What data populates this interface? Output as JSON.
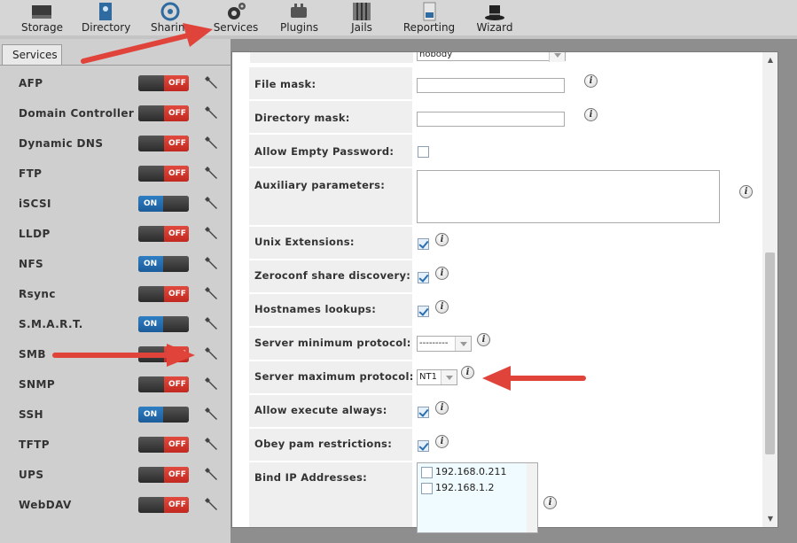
{
  "topnav": [
    {
      "label": "Storage",
      "icon": "storage-icon"
    },
    {
      "label": "Directory",
      "icon": "directory-icon"
    },
    {
      "label": "Sharing",
      "icon": "sharing-icon"
    },
    {
      "label": "Services",
      "icon": "services-icon"
    },
    {
      "label": "Plugins",
      "icon": "plugins-icon"
    },
    {
      "label": "Jails",
      "icon": "jails-icon"
    },
    {
      "label": "Reporting",
      "icon": "reporting-icon"
    },
    {
      "label": "Wizard",
      "icon": "wizard-icon"
    }
  ],
  "tab": {
    "label": "Services"
  },
  "services": [
    {
      "name": "AFP",
      "state": "OFF"
    },
    {
      "name": "Domain Controller",
      "state": "OFF"
    },
    {
      "name": "Dynamic DNS",
      "state": "OFF"
    },
    {
      "name": "FTP",
      "state": "OFF"
    },
    {
      "name": "iSCSI",
      "state": "ON"
    },
    {
      "name": "LLDP",
      "state": "OFF"
    },
    {
      "name": "NFS",
      "state": "ON"
    },
    {
      "name": "Rsync",
      "state": "OFF"
    },
    {
      "name": "S.M.A.R.T.",
      "state": "ON"
    },
    {
      "name": "SMB",
      "state": "OFF"
    },
    {
      "name": "SNMP",
      "state": "OFF"
    },
    {
      "name": "SSH",
      "state": "ON"
    },
    {
      "name": "TFTP",
      "state": "OFF"
    },
    {
      "name": "UPS",
      "state": "OFF"
    },
    {
      "name": "WebDAV",
      "state": "OFF"
    }
  ],
  "toggle_labels": {
    "on": "ON",
    "off": "OFF"
  },
  "form": {
    "guest_account": {
      "value": "nobody"
    },
    "file_mask": {
      "label": "File mask:",
      "value": ""
    },
    "directory_mask": {
      "label": "Directory mask:",
      "value": ""
    },
    "allow_empty_password": {
      "label": "Allow Empty Password:",
      "checked": false
    },
    "auxiliary_parameters": {
      "label": "Auxiliary parameters:",
      "value": ""
    },
    "unix_extensions": {
      "label": "Unix Extensions:",
      "checked": true
    },
    "zeroconf": {
      "label": "Zeroconf share discovery:",
      "checked": true
    },
    "hostnames_lookups": {
      "label": "Hostnames lookups:",
      "checked": true
    },
    "server_min_protocol": {
      "label": "Server minimum protocol:",
      "value": "---------"
    },
    "server_max_protocol": {
      "label": "Server maximum protocol:",
      "value": "NT1"
    },
    "allow_execute_always": {
      "label": "Allow execute always:",
      "checked": true
    },
    "obey_pam": {
      "label": "Obey pam restrictions:",
      "checked": true
    },
    "bind_ip": {
      "label": "Bind IP Addresses:",
      "options": [
        "192.168.0.211",
        "192.168.1.2"
      ]
    }
  },
  "info_glyph": "i"
}
